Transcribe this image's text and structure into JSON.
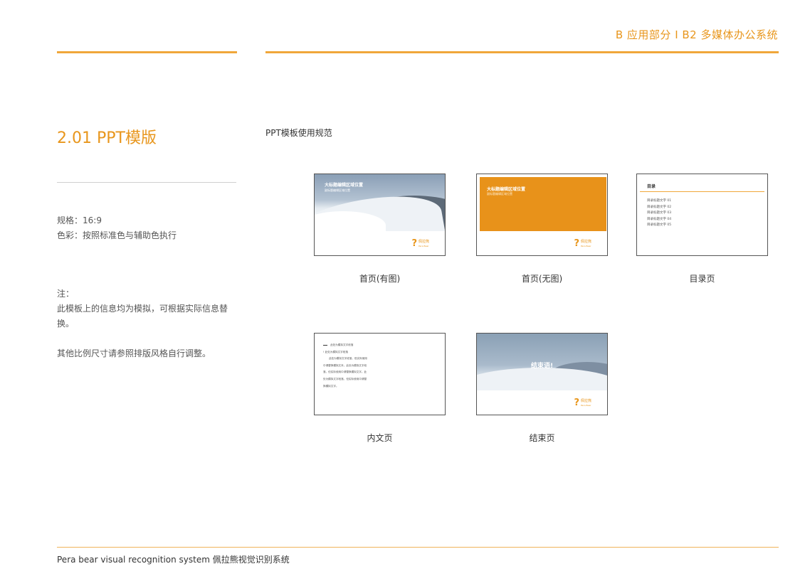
{
  "header": {
    "title": "B 应用部分 I B2  多媒体办公系统"
  },
  "section": {
    "title": "2.01 PPT模版"
  },
  "spec": {
    "lines": [
      "规格：16:9",
      "色彩：按照标准色与辅助色执行"
    ]
  },
  "note": {
    "label": "注：",
    "line1": "此模板上的信息均为模拟，可根据实际信息替换。",
    "line2": "其他比例尺寸请参照排版风格自行调整。"
  },
  "subheading": "PPT模板使用规范",
  "thumbnails": {
    "cover_image": {
      "caption": "首页(有图)",
      "title": "大标题编辑区域位置",
      "subtitle": "副标题编辑区域位置"
    },
    "cover_plain": {
      "caption": "首页(无图)",
      "title": "大标题编辑区域位置",
      "subtitle": "副标题编辑区域位置"
    },
    "toc": {
      "caption": "目录页",
      "title": "目录",
      "items": [
        "目录标题文字 01",
        "目录标题文字 02",
        "目录标题文字 03",
        "目录标题文字 04",
        "目录标题文字 05"
      ]
    },
    "content": {
      "caption": "内文页",
      "heading": "此处为模拟文字段落",
      "lines": [
        "! 此处为模拟文字段落",
        "此处为模拟文字段落，但实际使用",
        "中请替换模拟文本。此处为模拟文字段",
        "落，但实际使用中请替换模拟文字。此",
        "处为模拟文字段落，但实际使用中请替",
        "换模拟文字。"
      ]
    },
    "ending": {
      "caption": "结束页",
      "text": "结束语!"
    },
    "logo": {
      "zh": "佩拉熊",
      "en": "Pera Bear"
    }
  },
  "footer": {
    "text": "Pera bear visual recognition system  佩拉熊视觉识别系统"
  },
  "colors": {
    "accent": "#e8921a",
    "rule": "#f0a73a"
  }
}
